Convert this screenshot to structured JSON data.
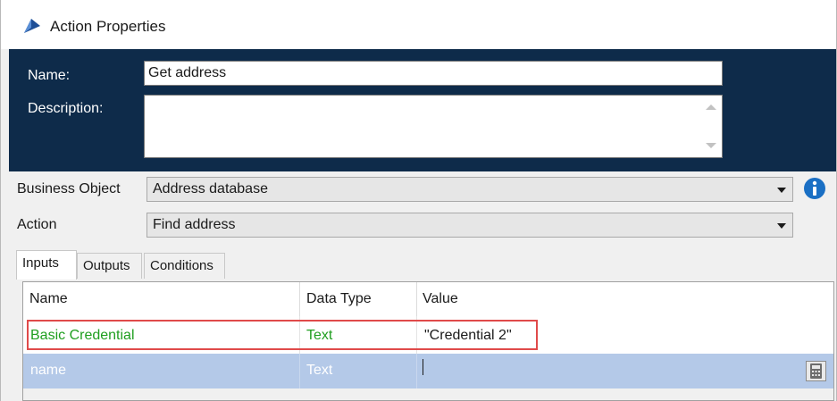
{
  "window": {
    "title": "Action Properties",
    "icon": "action-stage-icon"
  },
  "header": {
    "name_label": "Name:",
    "name_value": "Get address",
    "description_label": "Description:",
    "description_value": ""
  },
  "form": {
    "business_object_label": "Business Object",
    "business_object_value": "Address database",
    "action_label": "Action",
    "action_value": "Find address",
    "info_icon": "info-icon"
  },
  "tabs": [
    {
      "label": "Inputs",
      "active": true
    },
    {
      "label": "Outputs",
      "active": false
    },
    {
      "label": "Conditions",
      "active": false
    }
  ],
  "grid": {
    "headers": [
      "Name",
      "Data Type",
      "Value"
    ],
    "rows": [
      {
        "name": "Basic Credential",
        "type": "Text",
        "value": "\"Credential 2\"",
        "color": "#1f9e1f",
        "highlighted": true
      },
      {
        "name": "name",
        "type": "Text",
        "value": "",
        "color": "#ffffff",
        "selected": true
      }
    ],
    "row_action_icon": "calculator-icon"
  },
  "colors": {
    "header_band": "#0e2b4a",
    "selected_row": "#b4c9e8",
    "highlight_border": "#e04a4a",
    "credential_text": "#1f9e1f",
    "info_blue": "#1a6fc4"
  }
}
